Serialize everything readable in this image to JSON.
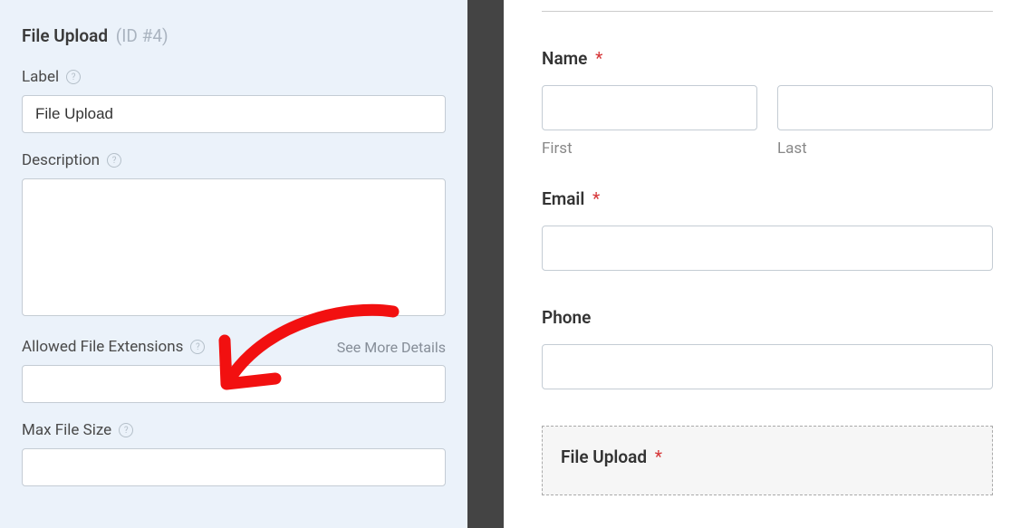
{
  "leftPanel": {
    "title": "File Upload",
    "idText": "(ID #4)",
    "labelField": {
      "label": "Label",
      "value": "File Upload"
    },
    "descriptionField": {
      "label": "Description",
      "value": ""
    },
    "allowedExtField": {
      "label": "Allowed File Extensions",
      "seeMore": "See More Details",
      "value": ""
    },
    "maxSizeField": {
      "label": "Max File Size",
      "value": ""
    }
  },
  "preview": {
    "name": {
      "label": "Name",
      "firstSub": "First",
      "lastSub": "Last"
    },
    "email": {
      "label": "Email"
    },
    "phone": {
      "label": "Phone"
    },
    "upload": {
      "label": "File Upload"
    },
    "asterisk": "*"
  }
}
